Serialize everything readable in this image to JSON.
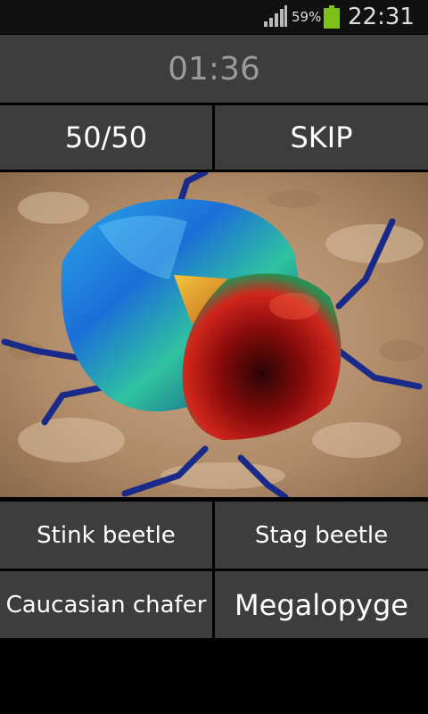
{
  "status_bar": {
    "battery_percent": "59%",
    "time": "22:31",
    "battery_color": "#7ec11a"
  },
  "game": {
    "timer": "01:36",
    "hint_label": "50/50",
    "skip_label": "SKIP",
    "answers": [
      "Stink beetle",
      "Stag beetle",
      "Caucasian chafer",
      "Megalopyge"
    ]
  },
  "colors": {
    "button_bg": "#3d3d3d",
    "timer_text": "#9a9a9a"
  },
  "icons": [
    "signal-icon",
    "battery-icon"
  ]
}
